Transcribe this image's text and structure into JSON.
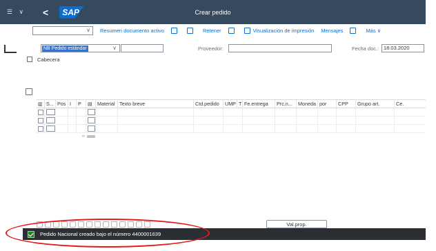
{
  "shell": {
    "back_label": "<",
    "logo_text": "SAP",
    "title": "Crear pedido"
  },
  "toolbar": {
    "items": [
      {
        "label": "Resumen documento activo"
      },
      {
        "label": ""
      },
      {
        "label": ""
      },
      {
        "label": "Retener"
      },
      {
        "label": ""
      },
      {
        "label": "Visualización de impresión"
      },
      {
        "label": "Mensajes"
      },
      {
        "label": ""
      },
      {
        "label": "Más"
      }
    ],
    "more_chevron": "∨"
  },
  "header": {
    "doc_type": "NB Pedido estándar",
    "vendor_label": "Proveedor:",
    "date_label": "Fecha doc.:",
    "date_value": "18.03.2020",
    "cabecera_label": "Cabecera"
  },
  "grid": {
    "columns": [
      "S...",
      "Pos",
      "I",
      "P",
      "",
      "Material",
      "Texto breve",
      "Ctd.pedido",
      "UMP",
      "T",
      "Fe.entrega",
      "Prc.n...",
      "Moneda",
      "por",
      "CPP",
      "Grupo art.",
      "Ce."
    ],
    "row_count": 3
  },
  "bottom": {
    "valprop_label": "Val.prop."
  },
  "status": {
    "message": "Pedido Nacional creado bajo el número 4400001639",
    "accent_color": "#2b7d2b"
  },
  "annotation": {
    "color": "#e31b1b"
  }
}
